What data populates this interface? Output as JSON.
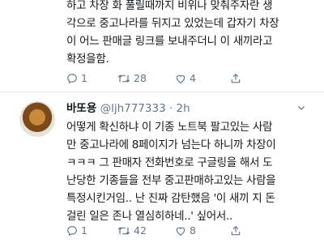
{
  "tweet1": {
    "lines": [
      "하고 차장 화 풀릴때까지 비위나 맞춰주자란 생",
      "각으로 중고나라를 뒤지고 있었는데 갑자기 차장",
      "이 어느 판매글 링크를 보내주더니 이 새끼라고",
      "확정을함."
    ],
    "actions": {
      "reply": "1",
      "retweet": "28",
      "like": "4"
    }
  },
  "tweet2": {
    "name": "바또용",
    "handle": "@ljh777333",
    "dot": "·",
    "time": "2h",
    "lines": [
      "어떻게 확신하냐 이 기종 노트북 팔고있는 사람",
      "만 중고나라에 8페이지가 넘는다 하니까 차장이",
      "ㅋㅋㅋ 그 판매자 전화번호로 구글링을 해서 도",
      "난당한 기종들을 전부 중고판매하고있는 사람을",
      "특정시킨거임.. 난 진짜 감탄했음 '이 새끼 지 돈",
      "걸린 일은 존나 열심히하네..' 싶어서.."
    ],
    "actions": {
      "reply": "1",
      "retweet": "42",
      "like": "8"
    }
  }
}
